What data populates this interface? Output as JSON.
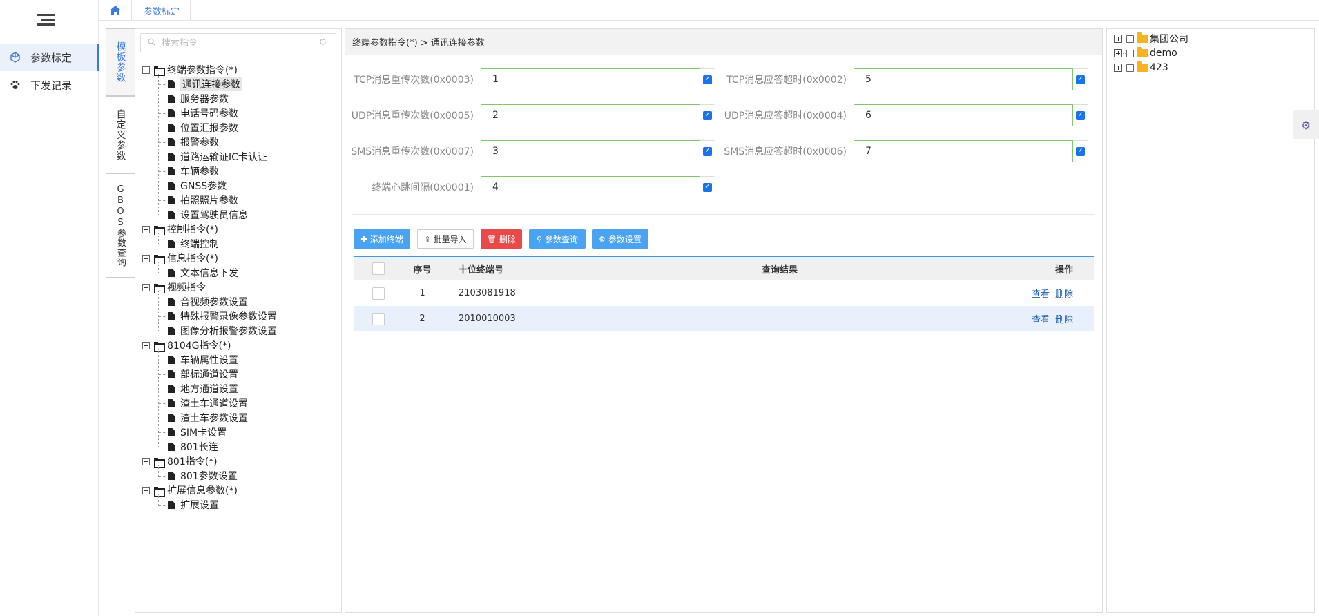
{
  "nav": {
    "items": [
      {
        "label": "参数标定",
        "icon": "cube-icon"
      },
      {
        "label": "下发记录",
        "icon": "paw-icon"
      }
    ]
  },
  "tabs": {
    "active": "参数标定"
  },
  "vertical_tabs": [
    {
      "label": "模板参数"
    },
    {
      "label": "自定义参数"
    },
    {
      "label": "GBOS参数查询"
    }
  ],
  "search": {
    "placeholder": "搜索指令"
  },
  "tree": {
    "groups": [
      {
        "label": "终端参数指令(*)",
        "items": [
          "通讯连接参数",
          "服务器参数",
          "电话号码参数",
          "位置汇报参数",
          "报警参数",
          "道路运输证IC卡认证",
          "车辆参数",
          "GNSS参数",
          "拍照照片参数",
          "设置驾驶员信息"
        ]
      },
      {
        "label": "控制指令(*)",
        "items": [
          "终端控制"
        ]
      },
      {
        "label": "信息指令(*)",
        "items": [
          "文本信息下发"
        ]
      },
      {
        "label": "视频指令",
        "items": [
          "音视频参数设置",
          "特殊报警录像参数设置",
          "图像分析报警参数设置"
        ]
      },
      {
        "label": "8104G指令(*)",
        "items": [
          "车辆属性设置",
          "部标通道设置",
          "地方通道设置",
          "渣土车通道设置",
          "渣土车参数设置",
          "SIM卡设置",
          "801长连"
        ]
      },
      {
        "label": "801指令(*)",
        "items": [
          "801参数设置"
        ]
      },
      {
        "label": "扩展信息参数(*)",
        "items": [
          "扩展设置"
        ]
      }
    ],
    "selected": "通讯连接参数"
  },
  "breadcrumb": "终端参数指令(*) > 通讯连接参数",
  "params": [
    {
      "label": "TCP消息重传次数(0x0003)",
      "value": "1",
      "checked": true
    },
    {
      "label": "TCP消息应答超时(0x0002)",
      "value": "5",
      "checked": true
    },
    {
      "label": "UDP消息重传次数(0x0005)",
      "value": "2",
      "checked": true
    },
    {
      "label": "UDP消息应答超时(0x0004)",
      "value": "6",
      "checked": true
    },
    {
      "label": "SMS消息重传次数(0x0007)",
      "value": "3",
      "checked": true
    },
    {
      "label": "SMS消息应答超时(0x0006)",
      "value": "7",
      "checked": true
    },
    {
      "label": "终端心跳间隔(0x0001)",
      "value": "4",
      "checked": true
    }
  ],
  "toolbar": {
    "add": "添加终端",
    "import": "批量导入",
    "delete": "删除",
    "query": "参数查询",
    "set": "参数设置"
  },
  "colors": {
    "add": "#4aa3f0",
    "delete": "#e84a4a",
    "query": "#4aa3f0",
    "set": "#4aa3f0",
    "accent": "#3b7ae0"
  },
  "table": {
    "headers": [
      "序号",
      "十位终端号",
      "查询结果",
      "操作"
    ],
    "rows": [
      {
        "no": "1",
        "terminal": "2103081918",
        "result": "",
        "view": "查看",
        "del": "删除"
      },
      {
        "no": "2",
        "terminal": "2010010003",
        "result": "",
        "view": "查看",
        "del": "删除"
      }
    ]
  },
  "org_tree": [
    "集团公司",
    "demo",
    "423"
  ]
}
